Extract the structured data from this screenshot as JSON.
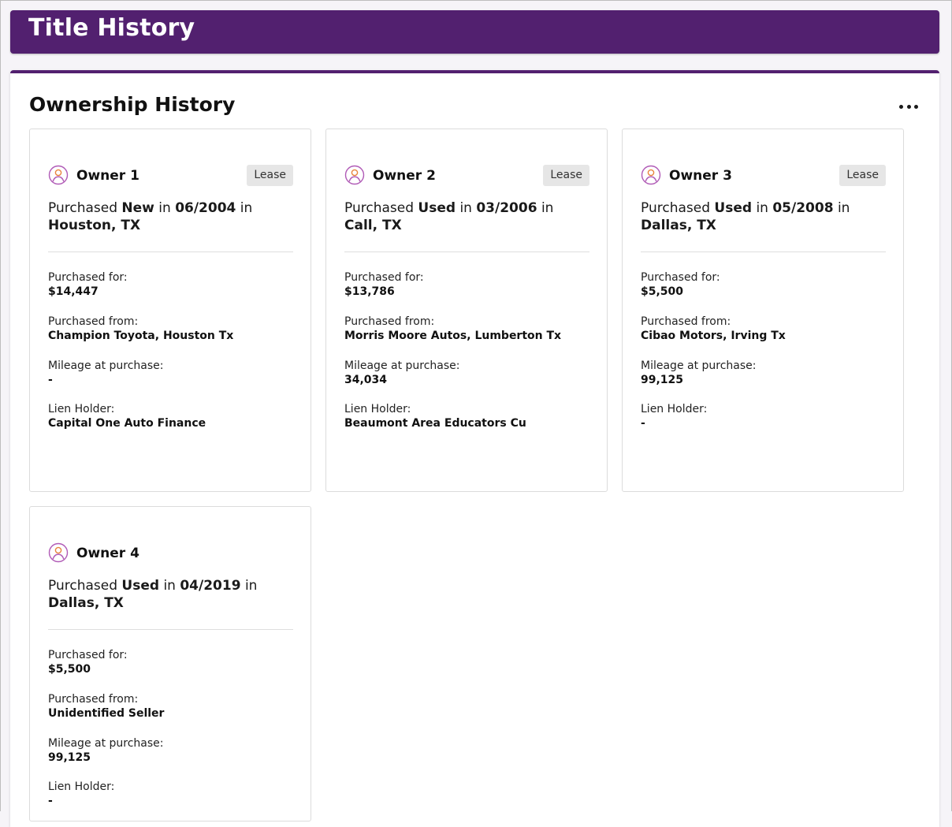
{
  "header": {
    "title": "Title History"
  },
  "section": {
    "title": "Ownership History",
    "more_label": "..."
  },
  "colors": {
    "brand": "#52206f",
    "icon_outer": "#b05ab6",
    "icon_inner": "#e8843c"
  },
  "labels": {
    "purchased": "Purchased",
    "in": "in",
    "purchased_for": "Purchased for:",
    "purchased_from": "Purchased from:",
    "mileage": "Mileage at purchase:",
    "lien_holder": "Lien Holder:"
  },
  "owners": [
    {
      "name": "Owner 1",
      "badge": "Lease",
      "condition": "New",
      "date": "06/2004",
      "location": "Houston, TX",
      "price": "$14,447",
      "seller": "Champion Toyota, Houston Tx",
      "mileage": "-",
      "lien": "Capital One Auto Finance"
    },
    {
      "name": "Owner 2",
      "badge": "Lease",
      "condition": "Used",
      "date": "03/2006",
      "location": "Call, TX",
      "price": "$13,786",
      "seller": "Morris Moore Autos, Lumberton Tx",
      "mileage": "34,034",
      "lien": "Beaumont Area Educators Cu"
    },
    {
      "name": "Owner 3",
      "badge": "Lease",
      "condition": "Used",
      "date": "05/2008",
      "location": "Dallas, TX",
      "price": "$5,500",
      "seller": "Cibao Motors, Irving Tx",
      "mileage": "99,125",
      "lien": "-"
    },
    {
      "name": "Owner 4",
      "badge": "",
      "condition": "Used",
      "date": "04/2019",
      "location": "Dallas, TX",
      "price": "$5,500",
      "seller": "Unidentified Seller",
      "mileage": "99,125",
      "lien": "-"
    }
  ]
}
